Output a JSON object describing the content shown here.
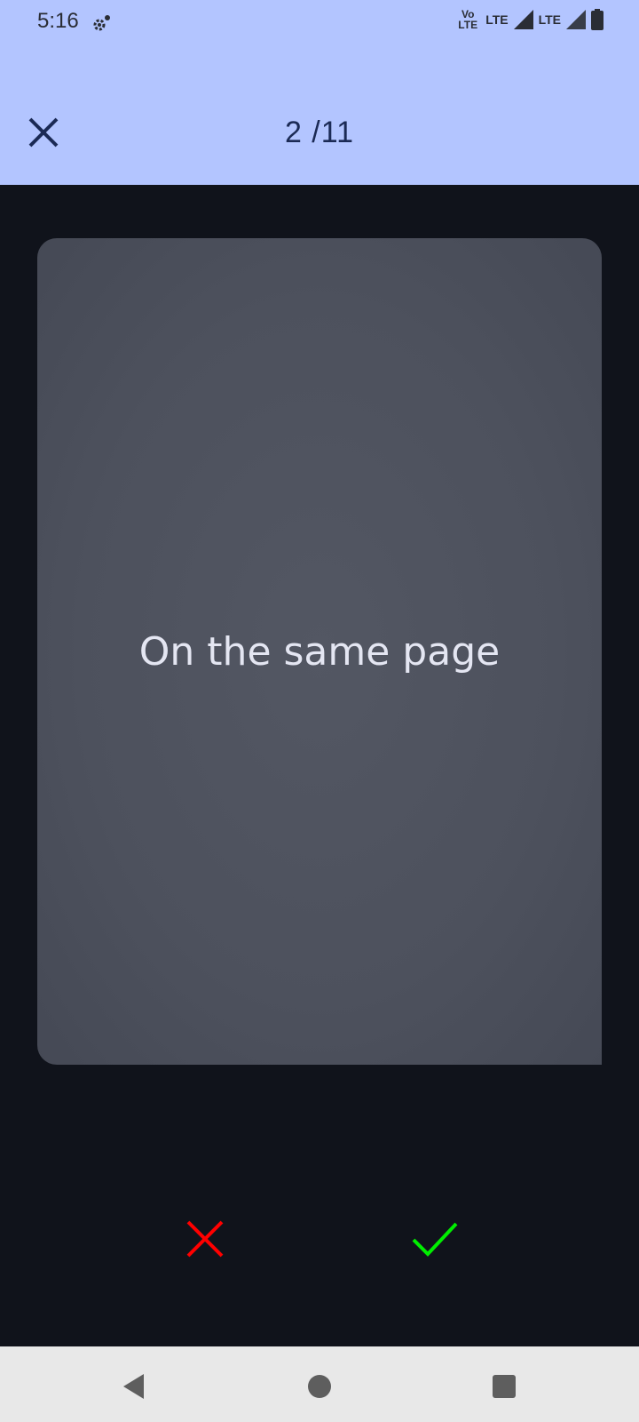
{
  "status_bar": {
    "time": "5:16",
    "volte_top": "Vo",
    "volte_bottom": "LTE",
    "lte1": "LTE",
    "lte2": "LTE"
  },
  "app_bar": {
    "counter": "2 /11"
  },
  "card": {
    "text": "On the same page"
  },
  "colors": {
    "header_bg": "#b3c5ff",
    "screen_bg": "#10131b",
    "card_bg": "#4e525e",
    "wrong": "#ff0000",
    "right": "#00ee00"
  },
  "icons": {
    "close": "close-icon",
    "wrong": "cross-icon",
    "right": "check-icon",
    "back": "back-triangle-icon",
    "home": "home-circle-icon",
    "recents": "recents-square-icon"
  }
}
